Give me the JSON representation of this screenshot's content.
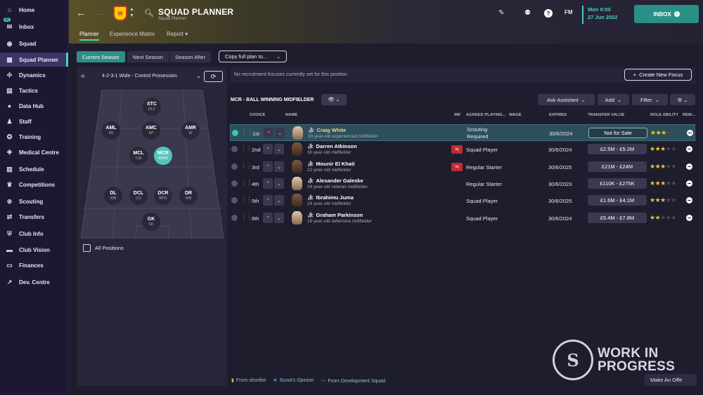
{
  "sidebar": {
    "items": [
      {
        "label": "Home",
        "icon": "home-icon",
        "glyph": "⌂"
      },
      {
        "label": "Inbox",
        "icon": "inbox-icon",
        "glyph": "✉",
        "badge": "22"
      },
      {
        "label": "Squad",
        "icon": "squad-icon",
        "glyph": "◉"
      },
      {
        "label": "Squad Planner",
        "icon": "squad-planner-icon",
        "glyph": "▦",
        "active": true
      },
      {
        "label": "Dynamics",
        "icon": "dynamics-icon",
        "glyph": "✣"
      },
      {
        "label": "Tactics",
        "icon": "tactics-icon",
        "glyph": "▤"
      },
      {
        "label": "Data Hub",
        "icon": "data-hub-icon",
        "glyph": "●"
      },
      {
        "label": "Staff",
        "icon": "staff-icon",
        "glyph": "♟"
      },
      {
        "label": "Training",
        "icon": "training-icon",
        "glyph": "✪"
      },
      {
        "label": "Medical Centre",
        "icon": "medical-icon",
        "glyph": "✚"
      },
      {
        "label": "Schedule",
        "icon": "schedule-icon",
        "glyph": "▥"
      },
      {
        "label": "Competitions",
        "icon": "trophy-icon",
        "glyph": "♛"
      },
      {
        "label": "Scouting",
        "icon": "scouting-icon",
        "glyph": "⊕"
      },
      {
        "label": "Transfers",
        "icon": "transfers-icon",
        "glyph": "⇄"
      },
      {
        "label": "Club Info",
        "icon": "club-info-icon",
        "glyph": "⛨"
      },
      {
        "label": "Club Vision",
        "icon": "club-vision-icon",
        "glyph": "▬"
      },
      {
        "label": "Finances",
        "icon": "finances-icon",
        "glyph": "▭"
      },
      {
        "label": "Dev. Centre",
        "icon": "dev-centre-icon",
        "glyph": "↗"
      }
    ]
  },
  "header": {
    "title": "SQUAD PLANNER",
    "subtitle": "Squad Planner",
    "tabs": [
      {
        "label": "Planner"
      },
      {
        "label": "Experience Matrix"
      },
      {
        "label": "Report ▾"
      }
    ],
    "date_line1": "Mon 9:00",
    "date_line2": "27 Jun 2022",
    "inbox_label": "INBOX",
    "fm_label": "FM",
    "crest_letter": "W"
  },
  "planner": {
    "seasons": [
      "Current Season",
      "Next Season",
      "Season After"
    ],
    "copy_plan": "Copy full plan to...",
    "formation": "4-2-3-1 Wide - Control Possession",
    "all_positions": "All Positions",
    "pitch_positions": [
      {
        "code": "STC",
        "role": "DLF"
      },
      {
        "code": "AML",
        "role": "IW"
      },
      {
        "code": "AMC",
        "role": "AP"
      },
      {
        "code": "AMR",
        "role": "W"
      },
      {
        "code": "MCL",
        "role": "CM"
      },
      {
        "code": "MCR",
        "role": "BWM",
        "selected": true
      },
      {
        "code": "DL",
        "role": "WB"
      },
      {
        "code": "DCL",
        "role": "CD"
      },
      {
        "code": "DCR",
        "role": "BPD"
      },
      {
        "code": "DR",
        "role": "WB"
      },
      {
        "code": "GK",
        "role": "SK"
      }
    ]
  },
  "focus": {
    "text": "No recruitment focuses currently set for this position",
    "new_focus": "Create New Focus"
  },
  "role_table": {
    "title": "MCR - BALL WINNING MIDFIELDER",
    "toolbar": {
      "ask_assistant": "Ask Assistant",
      "add": "Add",
      "filter": "Filter"
    },
    "columns": [
      "CHOICE",
      "NAME",
      "INF",
      "AGREED PLAYING...",
      "WAGE",
      "EXPIRES",
      "TRANSFER VALUE",
      "ROLE ABILITY",
      "REM..."
    ],
    "rows": [
      {
        "choice": "1st",
        "name": "Craig White",
        "desc": "33 year-old experienced midfielder",
        "inf": "",
        "status": "Scouting Required",
        "expires": "30/6/2024",
        "value": "Not for Sale",
        "stars": "★★★",
        "stars_off": "★★",
        "highlight": true
      },
      {
        "choice": "2nd",
        "name": "Darren Atkinson",
        "desc": "30 year-old midfielder",
        "inf": "Inj",
        "status": "Squad Player",
        "expires": "30/6/2024",
        "value": "£2.5M - £5.2M",
        "stars": "★★★",
        "stars_off": "★★"
      },
      {
        "choice": "3rd",
        "name": "Mounir El Khati",
        "desc": "22 year-old midfielder",
        "inf": "Inj",
        "status": "Regular Starter",
        "expires": "30/6/2025",
        "value": "£21M - £24M",
        "stars": "★★★",
        "stars_off": "★★"
      },
      {
        "choice": "4th",
        "name": "Alexander Galeske",
        "desc": "34 year-old veteran midfielder",
        "inf": "",
        "status": "Regular Starter",
        "expires": "30/6/2023",
        "value": "£110K - £275K",
        "stars": "★★★",
        "stars_off": "★★"
      },
      {
        "choice": "5th",
        "name": "Ibrahimu Juma",
        "desc": "24 year-old midfielder",
        "inf": "",
        "status": "Squad Player",
        "expires": "30/6/2025",
        "value": "£1.6M - £4.1M",
        "stars": "★★★",
        "stars_off": "★★"
      },
      {
        "choice": "6th",
        "name": "Graham Parkinson",
        "desc": "19 year-old defensive midfielder",
        "inf": "",
        "status": "Squad Player",
        "expires": "30/6/2024",
        "value": "£5.4M - £7.8M",
        "stars": "★★",
        "stars_off": "★★★"
      }
    ]
  },
  "legend": {
    "shortlist": "From shortlist",
    "scout": "Scout's Opinion",
    "dev_squad": "From Development Squad"
  },
  "watermark": {
    "logo_letter": "S",
    "line1": "WORK IN",
    "line2": "PROGRESS"
  },
  "make_offer": "Make An Offe"
}
